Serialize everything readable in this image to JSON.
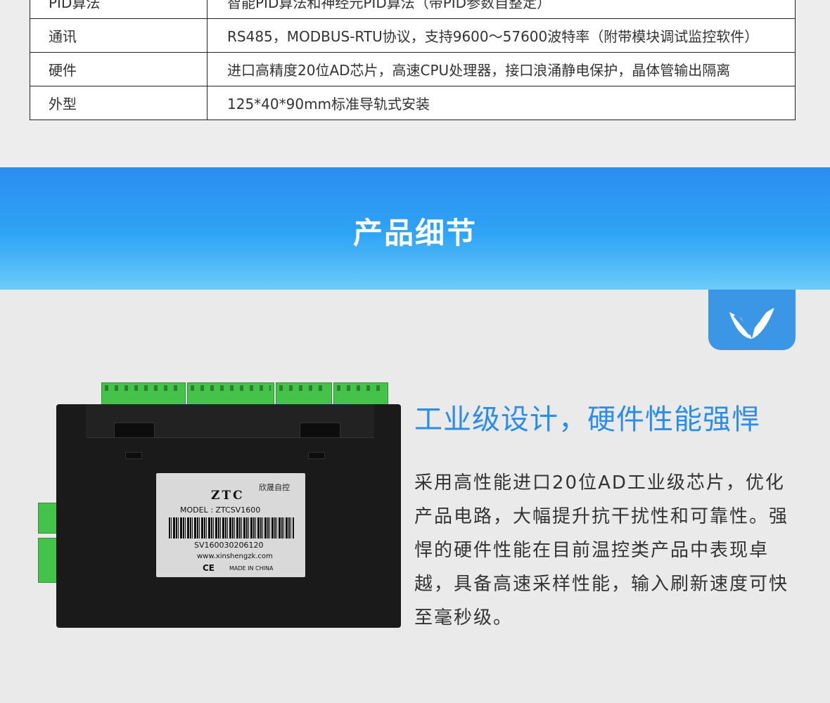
{
  "spec_table": {
    "rows": [
      {
        "key": "PID算法",
        "value": "智能PID算法和神经元PID算法（带PID参数自整定）"
      },
      {
        "key": "通讯",
        "value": "RS485，MODBUS-RTU协议，支持9600～57600波特率（附带模块调试监控软件）"
      },
      {
        "key": "硬件",
        "value": "进口高精度20位AD芯片，高速CPU处理器，接口浪涌静电保护，晶体管输出隔离"
      },
      {
        "key": "外型",
        "value": "125*40*90mm标准导轨式安装"
      }
    ]
  },
  "banner": {
    "title": "产品细节"
  },
  "logo": {
    "icon": "leaf-check-logo-icon",
    "color": "#3b96e6"
  },
  "device_label": {
    "brand": "ZTC",
    "brand_cn": "欣晟自控",
    "model": "MODEL : ZTCSV1600",
    "serial": "SV160030206120",
    "website": "www.xinshengzk.com",
    "ce": "CE",
    "made_in": "MADE IN CHINA"
  },
  "feature": {
    "title": "工业级设计，硬件性能强悍",
    "body": "采用高性能进口20位AD工业级芯片，优化产品电路，大幅提升抗干扰性和可靠性。强悍的硬件性能在目前温控类产品中表现卓越，具备高速采样性能，输入刷新速度可快至毫秒级。"
  },
  "colors": {
    "accent": "#2b8de8",
    "banner_top": "#2b8df0",
    "banner_bottom": "#6ccbf9",
    "terminal_green": "#45c24a"
  }
}
